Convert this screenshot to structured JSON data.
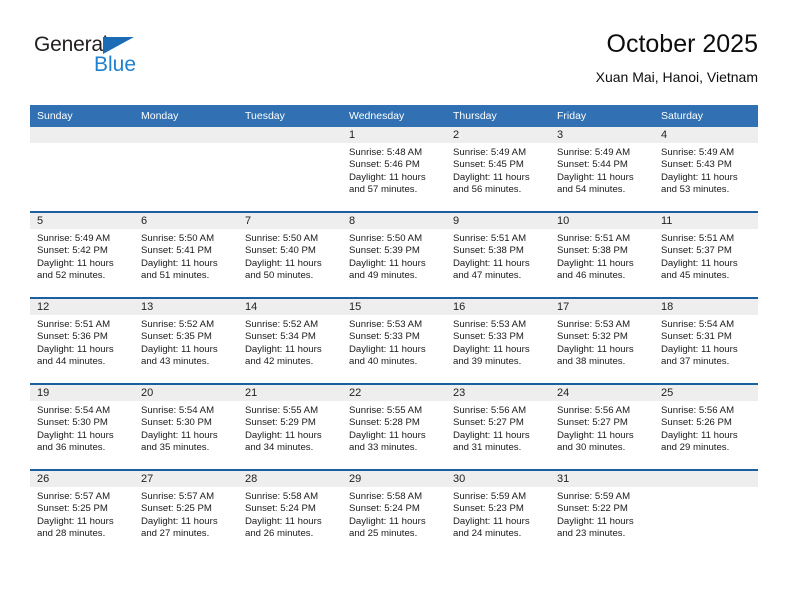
{
  "brand": {
    "name_top": "General",
    "name_bottom": "Blue",
    "triangle_color": "#1b6cb5",
    "blue_color": "#2081cf"
  },
  "header": {
    "title": "October 2025",
    "subtitle": "Xuan Mai, Hanoi, Vietnam"
  },
  "theme": {
    "header_bg": "#3070b3",
    "row_divider": "#1c5fa0",
    "daynum_band": "#eeeeee"
  },
  "calendar": {
    "weekday_headers": [
      "Sunday",
      "Monday",
      "Tuesday",
      "Wednesday",
      "Thursday",
      "Friday",
      "Saturday"
    ],
    "weeks": [
      [
        {
          "day": "",
          "lines": []
        },
        {
          "day": "",
          "lines": []
        },
        {
          "day": "",
          "lines": []
        },
        {
          "day": "1",
          "lines": [
            "Sunrise: 5:48 AM",
            "Sunset: 5:46 PM",
            "Daylight: 11 hours",
            "and 57 minutes."
          ]
        },
        {
          "day": "2",
          "lines": [
            "Sunrise: 5:49 AM",
            "Sunset: 5:45 PM",
            "Daylight: 11 hours",
            "and 56 minutes."
          ]
        },
        {
          "day": "3",
          "lines": [
            "Sunrise: 5:49 AM",
            "Sunset: 5:44 PM",
            "Daylight: 11 hours",
            "and 54 minutes."
          ]
        },
        {
          "day": "4",
          "lines": [
            "Sunrise: 5:49 AM",
            "Sunset: 5:43 PM",
            "Daylight: 11 hours",
            "and 53 minutes."
          ]
        }
      ],
      [
        {
          "day": "5",
          "lines": [
            "Sunrise: 5:49 AM",
            "Sunset: 5:42 PM",
            "Daylight: 11 hours",
            "and 52 minutes."
          ]
        },
        {
          "day": "6",
          "lines": [
            "Sunrise: 5:50 AM",
            "Sunset: 5:41 PM",
            "Daylight: 11 hours",
            "and 51 minutes."
          ]
        },
        {
          "day": "7",
          "lines": [
            "Sunrise: 5:50 AM",
            "Sunset: 5:40 PM",
            "Daylight: 11 hours",
            "and 50 minutes."
          ]
        },
        {
          "day": "8",
          "lines": [
            "Sunrise: 5:50 AM",
            "Sunset: 5:39 PM",
            "Daylight: 11 hours",
            "and 49 minutes."
          ]
        },
        {
          "day": "9",
          "lines": [
            "Sunrise: 5:51 AM",
            "Sunset: 5:38 PM",
            "Daylight: 11 hours",
            "and 47 minutes."
          ]
        },
        {
          "day": "10",
          "lines": [
            "Sunrise: 5:51 AM",
            "Sunset: 5:38 PM",
            "Daylight: 11 hours",
            "and 46 minutes."
          ]
        },
        {
          "day": "11",
          "lines": [
            "Sunrise: 5:51 AM",
            "Sunset: 5:37 PM",
            "Daylight: 11 hours",
            "and 45 minutes."
          ]
        }
      ],
      [
        {
          "day": "12",
          "lines": [
            "Sunrise: 5:51 AM",
            "Sunset: 5:36 PM",
            "Daylight: 11 hours",
            "and 44 minutes."
          ]
        },
        {
          "day": "13",
          "lines": [
            "Sunrise: 5:52 AM",
            "Sunset: 5:35 PM",
            "Daylight: 11 hours",
            "and 43 minutes."
          ]
        },
        {
          "day": "14",
          "lines": [
            "Sunrise: 5:52 AM",
            "Sunset: 5:34 PM",
            "Daylight: 11 hours",
            "and 42 minutes."
          ]
        },
        {
          "day": "15",
          "lines": [
            "Sunrise: 5:53 AM",
            "Sunset: 5:33 PM",
            "Daylight: 11 hours",
            "and 40 minutes."
          ]
        },
        {
          "day": "16",
          "lines": [
            "Sunrise: 5:53 AM",
            "Sunset: 5:33 PM",
            "Daylight: 11 hours",
            "and 39 minutes."
          ]
        },
        {
          "day": "17",
          "lines": [
            "Sunrise: 5:53 AM",
            "Sunset: 5:32 PM",
            "Daylight: 11 hours",
            "and 38 minutes."
          ]
        },
        {
          "day": "18",
          "lines": [
            "Sunrise: 5:54 AM",
            "Sunset: 5:31 PM",
            "Daylight: 11 hours",
            "and 37 minutes."
          ]
        }
      ],
      [
        {
          "day": "19",
          "lines": [
            "Sunrise: 5:54 AM",
            "Sunset: 5:30 PM",
            "Daylight: 11 hours",
            "and 36 minutes."
          ]
        },
        {
          "day": "20",
          "lines": [
            "Sunrise: 5:54 AM",
            "Sunset: 5:30 PM",
            "Daylight: 11 hours",
            "and 35 minutes."
          ]
        },
        {
          "day": "21",
          "lines": [
            "Sunrise: 5:55 AM",
            "Sunset: 5:29 PM",
            "Daylight: 11 hours",
            "and 34 minutes."
          ]
        },
        {
          "day": "22",
          "lines": [
            "Sunrise: 5:55 AM",
            "Sunset: 5:28 PM",
            "Daylight: 11 hours",
            "and 33 minutes."
          ]
        },
        {
          "day": "23",
          "lines": [
            "Sunrise: 5:56 AM",
            "Sunset: 5:27 PM",
            "Daylight: 11 hours",
            "and 31 minutes."
          ]
        },
        {
          "day": "24",
          "lines": [
            "Sunrise: 5:56 AM",
            "Sunset: 5:27 PM",
            "Daylight: 11 hours",
            "and 30 minutes."
          ]
        },
        {
          "day": "25",
          "lines": [
            "Sunrise: 5:56 AM",
            "Sunset: 5:26 PM",
            "Daylight: 11 hours",
            "and 29 minutes."
          ]
        }
      ],
      [
        {
          "day": "26",
          "lines": [
            "Sunrise: 5:57 AM",
            "Sunset: 5:25 PM",
            "Daylight: 11 hours",
            "and 28 minutes."
          ]
        },
        {
          "day": "27",
          "lines": [
            "Sunrise: 5:57 AM",
            "Sunset: 5:25 PM",
            "Daylight: 11 hours",
            "and 27 minutes."
          ]
        },
        {
          "day": "28",
          "lines": [
            "Sunrise: 5:58 AM",
            "Sunset: 5:24 PM",
            "Daylight: 11 hours",
            "and 26 minutes."
          ]
        },
        {
          "day": "29",
          "lines": [
            "Sunrise: 5:58 AM",
            "Sunset: 5:24 PM",
            "Daylight: 11 hours",
            "and 25 minutes."
          ]
        },
        {
          "day": "30",
          "lines": [
            "Sunrise: 5:59 AM",
            "Sunset: 5:23 PM",
            "Daylight: 11 hours",
            "and 24 minutes."
          ]
        },
        {
          "day": "31",
          "lines": [
            "Sunrise: 5:59 AM",
            "Sunset: 5:22 PM",
            "Daylight: 11 hours",
            "and 23 minutes."
          ]
        },
        {
          "day": "",
          "lines": []
        }
      ]
    ]
  }
}
